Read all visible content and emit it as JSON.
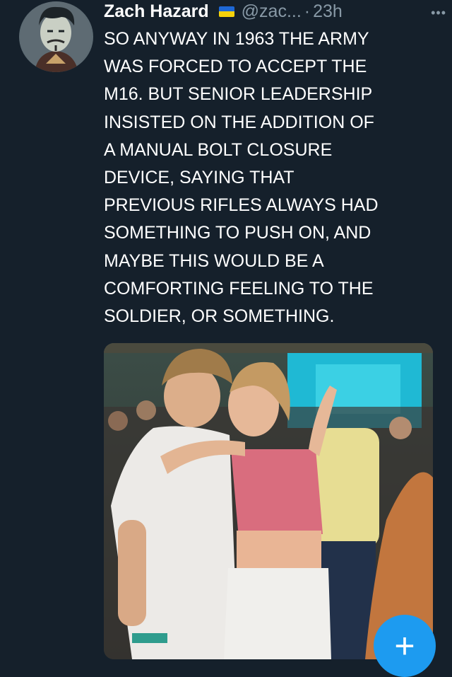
{
  "tweet": {
    "display_name": "Zach Hazard",
    "handle": "@zac...",
    "separator": "·",
    "time": "23h",
    "more_label": "•••",
    "text": "SO ANYWAY IN 1963 THE ARMY\nWAS FORCED TO ACCEPT THE\nM16. BUT SENIOR LEADERSHIP\nINSISTED ON THE ADDITION OF\nA MANUAL BOLT CLOSURE\nDEVICE, SAYING THAT\nPREVIOUS RIFLES ALWAYS HAD\nSOMETHING TO PUSH ON, AND\nMAYBE THIS WOULD BE A\nCOMFORTING FEELING TO THE\nSOLDIER, OR SOMETHING."
  },
  "compose_button": {
    "label": "+",
    "color": "#1d9bf0"
  },
  "colors": {
    "background": "#15202b",
    "secondary_text": "#8899a6",
    "flag_blue": "#1e68d6",
    "flag_yellow": "#f5d20b"
  }
}
